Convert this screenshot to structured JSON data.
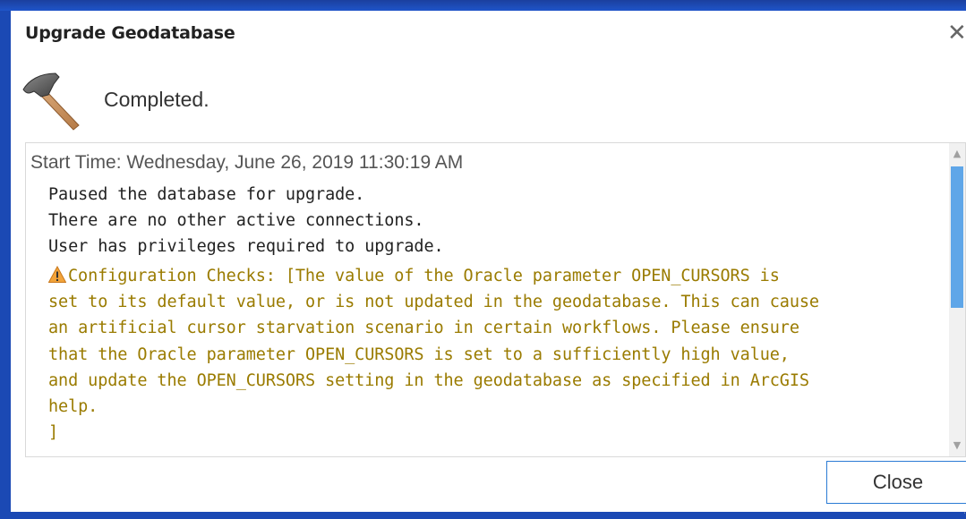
{
  "dialog": {
    "title": "Upgrade Geodatabase",
    "close_glyph": "✕",
    "status_icon": "hammer-icon",
    "status_text": "Completed.",
    "log": {
      "start_time": "Start Time: Wednesday, June 26, 2019 11:30:19 AM",
      "messages": [
        "Paused the database for upgrade.",
        "There are no other active connections.",
        "User has privileges required to upgrade."
      ],
      "warning_icon": "warning-icon",
      "warning_lines": [
        "Configuration Checks: [The value of the Oracle parameter OPEN_CURSORS is",
        "set to its default value, or is not updated in the geodatabase. This can cause",
        "an artificial cursor starvation scenario in certain workflows. Please ensure",
        "that the Oracle parameter OPEN_CURSORS is set to a sufficiently high value,",
        "and update the OPEN_CURSORS setting in the geodatabase as specified in ArcGIS",
        "help.",
        "]"
      ]
    },
    "close_button_label": "Close"
  },
  "colors": {
    "desktop_blue": "#1b49b4",
    "warning_text": "#9a7b00",
    "warning_icon": "#f2a33a",
    "scroll_thumb": "#5fa6e8",
    "button_border": "#2b7bd4"
  }
}
